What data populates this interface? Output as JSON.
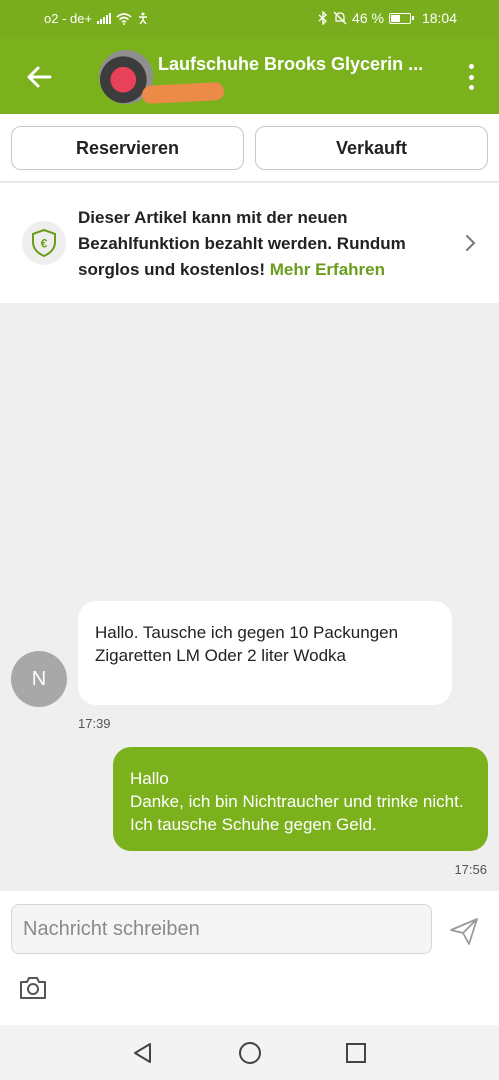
{
  "status_bar": {
    "carrier": "o2 - de+",
    "battery_text": "46 %",
    "battery_level": 0.46,
    "time": "18:04"
  },
  "header": {
    "title": "Laufschuhe Brooks Glycerin ...",
    "back_icon": "arrow-left-icon",
    "menu_icon": "more-vertical-icon"
  },
  "actions": {
    "reserve_label": "Reservieren",
    "sold_label": "Verkauft"
  },
  "banner": {
    "text": "Dieser Artikel kann mit der neuen Bezahlfunktion bezahlt werden. Rundum sorglos und kostenlos! ",
    "link": "Mehr Erfahren",
    "icon": "shield-euro-icon"
  },
  "chat": {
    "partner_initial": "N",
    "messages": [
      {
        "direction": "in",
        "text": "Hallo. Tausche ich gegen 10 Packungen Zigaretten LM Oder 2 liter Wodka",
        "time": "17:39"
      },
      {
        "direction": "out",
        "text": "Hallo\nDanke, ich bin Nichtraucher und trinke nicht. Ich tausche Schuhe gegen Geld.",
        "time": "17:56"
      }
    ]
  },
  "composer": {
    "placeholder": "Nachricht schreiben",
    "send_icon": "send-icon",
    "camera_icon": "camera-icon"
  },
  "colors": {
    "brand_green": "#7cb11e",
    "link_green": "#6a9e1c",
    "background": "#efefef"
  }
}
